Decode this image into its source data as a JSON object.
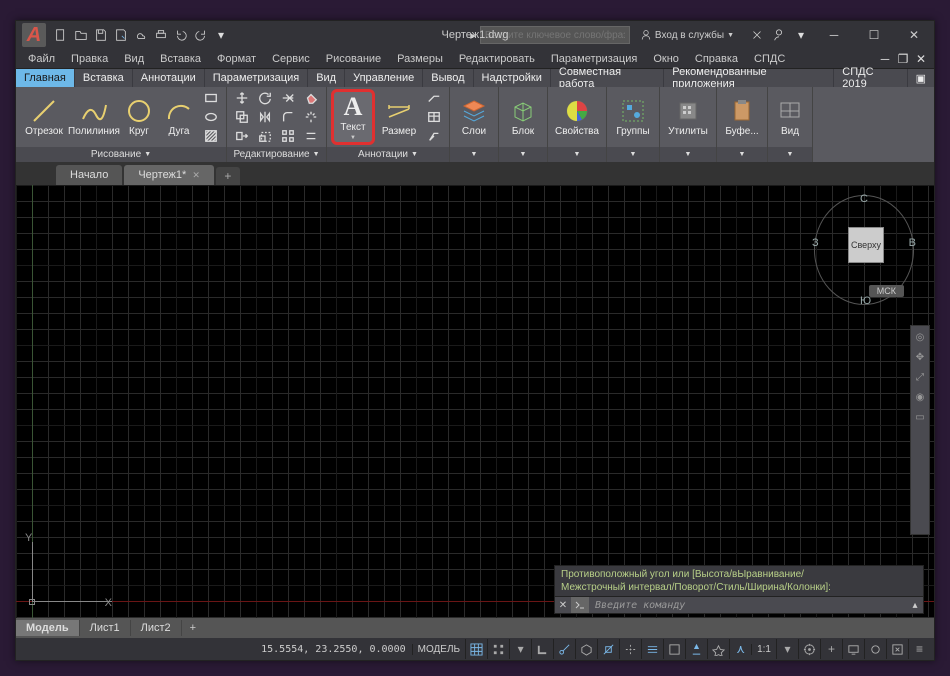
{
  "title": "Чертеж1.dwg",
  "search_placeholder": "Введите ключевое слово/фразу",
  "signin_label": "Вход в службы",
  "menubar": [
    "Файл",
    "Правка",
    "Вид",
    "Вставка",
    "Формат",
    "Сервис",
    "Рисование",
    "Размеры",
    "Редактировать",
    "Параметризация",
    "Окно",
    "Справка",
    "СПДС"
  ],
  "ribbon_tabs": [
    "Главная",
    "Вставка",
    "Аннотации",
    "Параметризация",
    "Вид",
    "Управление",
    "Вывод",
    "Надстройки",
    "Совместная работа",
    "Рекомендованные приложения",
    "СПДС 2019"
  ],
  "ribbon": {
    "draw": {
      "title": "Рисование",
      "line": "Отрезок",
      "polyline": "Полилиния",
      "circle": "Круг",
      "arc": "Дуга"
    },
    "modify": {
      "title": "Редактирование"
    },
    "annot": {
      "title": "Аннотации",
      "text": "Текст",
      "dim": "Размер"
    },
    "layers": {
      "title": "Слои"
    },
    "block": {
      "title": "Блок"
    },
    "props": {
      "title": "Свойства"
    },
    "groups": {
      "title": "Группы"
    },
    "utils": {
      "title": "Утилиты"
    },
    "clip": {
      "title": "Буфе..."
    },
    "view": {
      "title": "Вид"
    }
  },
  "file_tabs": {
    "start": "Начало",
    "drawing": "Чертеж1*"
  },
  "viewcube": {
    "top": "Сверху",
    "n": "С",
    "s": "Ю",
    "e": "В",
    "w": "З",
    "wcs": "МСК"
  },
  "ucs": {
    "x": "X",
    "y": "Y"
  },
  "cmd": {
    "hist1": "Противоположный угол или [Высота/вЫравнивание/",
    "hist2": "Межстрочный интервал/Поворот/Стиль/Ширина/Колонки]:",
    "placeholder": "Введите команду"
  },
  "layout_tabs": {
    "model": "Модель",
    "l1": "Лист1",
    "l2": "Лист2"
  },
  "status": {
    "coords": "15.5554, 23.2550, 0.0000",
    "model": "МОДЕЛЬ",
    "scale": "1:1"
  }
}
